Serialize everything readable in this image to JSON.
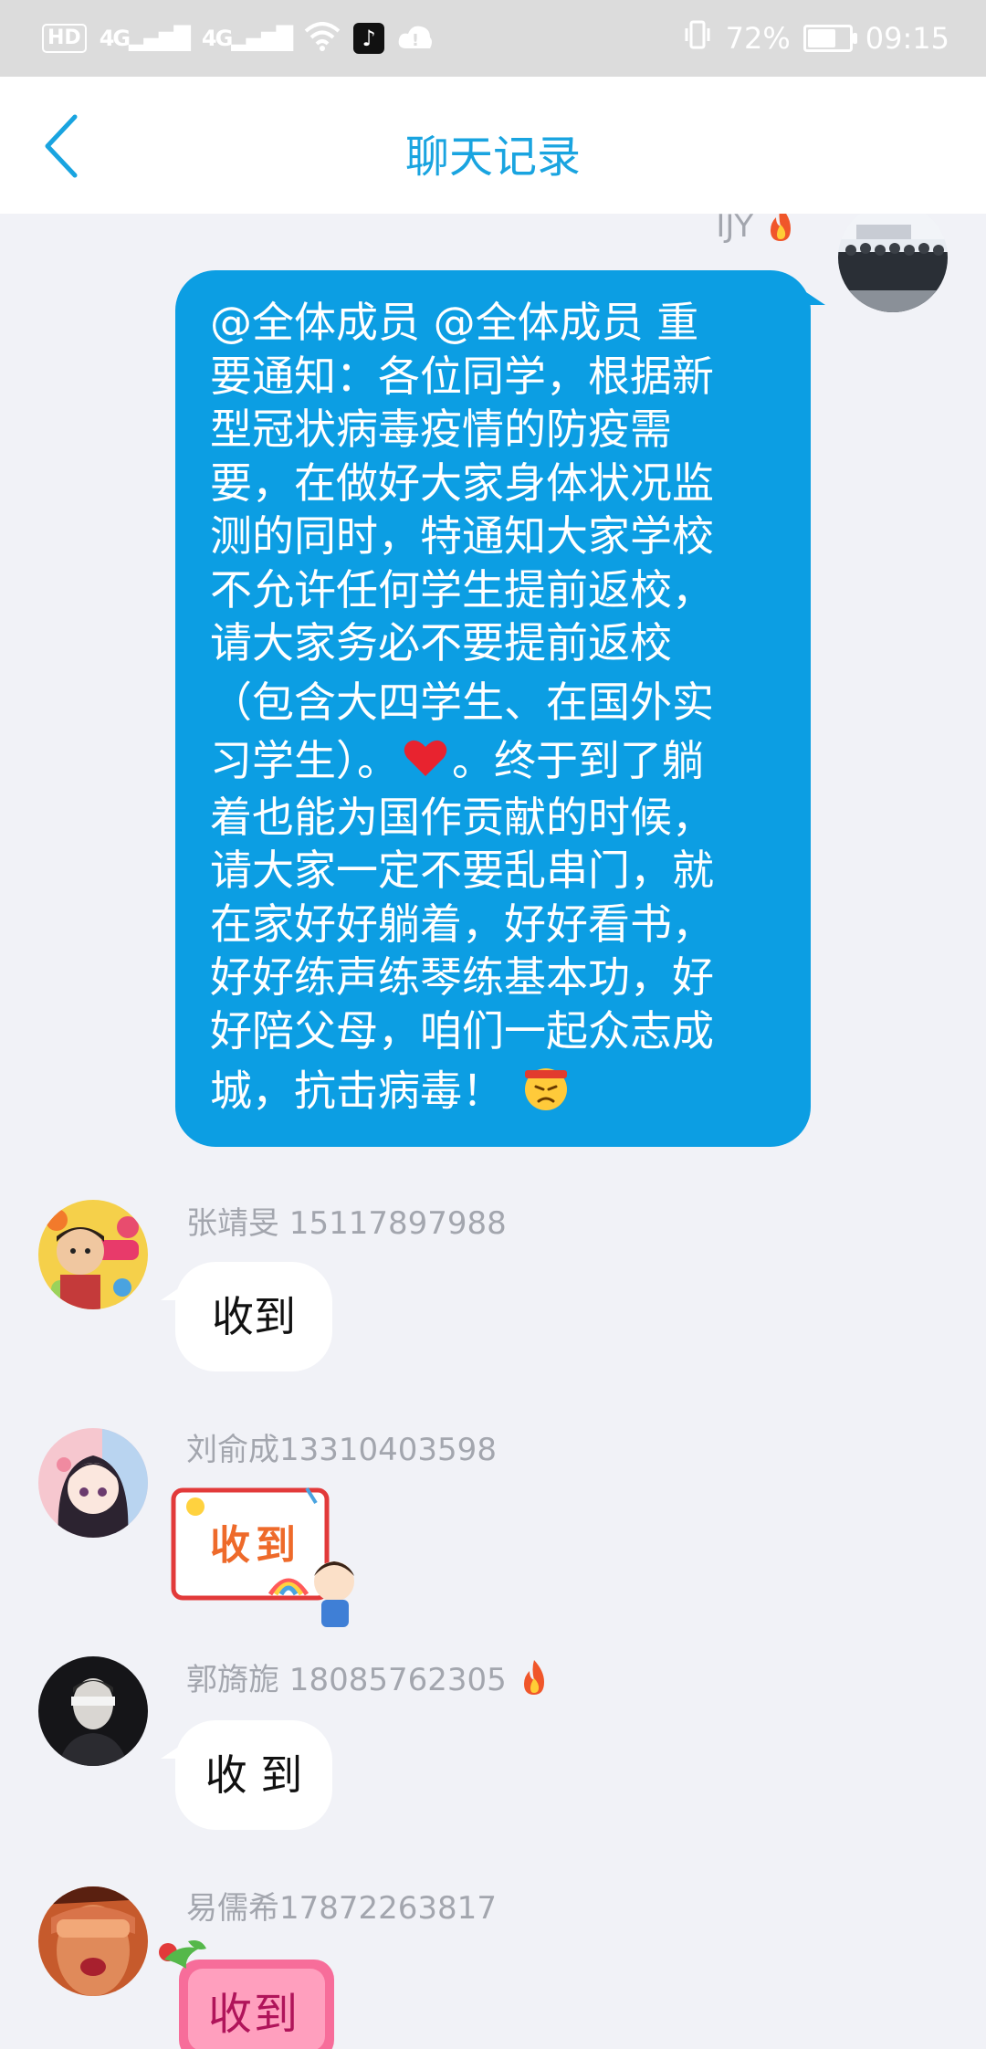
{
  "status_bar": {
    "hd_label": "HD",
    "sim1": "4G",
    "sim2": "4G",
    "battery_percent": "72%",
    "battery_level": 0.72,
    "time": "09:15"
  },
  "header": {
    "title": "聊天记录",
    "back_icon": "chevron-left-icon"
  },
  "messages": [
    {
      "sender": "IJY",
      "side": "right",
      "badge_icon": "fire-icon",
      "lines": [
        "@全体成员 @全体成员 重",
        "要通知：各位同学，根据新",
        "型冠状病毒疫情的防疫需",
        "要，在做好大家身体状况监",
        "测的同时，特通知大家学校",
        "不允许任何学生提前返校，",
        "请大家务必不要提前返校",
        "（包含大四学生、在国外实",
        "习学生）。",
        "。终于到了躺",
        "着也能为国作贡献的时候，",
        "请大家一定不要乱串门，就",
        "在家好好躺着，好好看书，",
        "好好练声练琴练基本功，好",
        "好陪父母，咱们一起众志成",
        "城，抗击病毒！"
      ],
      "emoji_icons": [
        "heart-icon",
        "fighting-face-icon"
      ]
    },
    {
      "sender": "张靖旻 15117897988",
      "side": "left",
      "text": "收到"
    },
    {
      "sender": "刘俞成13310403598",
      "side": "left",
      "sticker_text": "收到"
    },
    {
      "sender": "郭旖旎 18085762305",
      "side": "left",
      "badge_icon": "fire-icon",
      "text": "收 到"
    },
    {
      "sender": "易儒希17872263817",
      "side": "left",
      "sticker_text": "收到"
    }
  ],
  "colors": {
    "accent": "#19a4e0",
    "bubble_blue": "#0c9ee3",
    "background": "#f1f2f7",
    "status_bar": "#dcdcdc",
    "name_gray": "#a3a6ae"
  }
}
